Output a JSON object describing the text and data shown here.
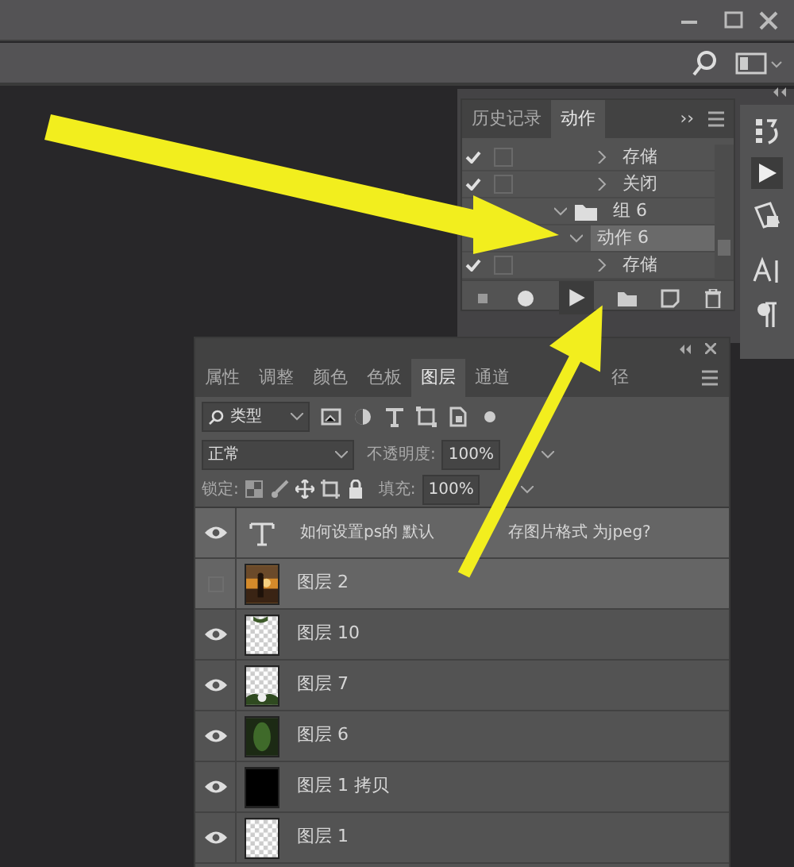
{
  "actions_panel": {
    "tabs": [
      {
        "label": "历史记录",
        "selected": false
      },
      {
        "label": "动作",
        "selected": true
      }
    ],
    "overflow": "››",
    "rows": [
      {
        "label": "存储",
        "checked": true,
        "expanded": false,
        "kind": "step",
        "selected": false
      },
      {
        "label": "关闭",
        "checked": true,
        "expanded": false,
        "kind": "step",
        "selected": false
      },
      {
        "label": "组 6",
        "checked": false,
        "expanded": true,
        "kind": "set",
        "selected": false
      },
      {
        "label": "动作 6",
        "checked": false,
        "expanded": true,
        "kind": "action",
        "selected": true
      },
      {
        "label": "存储",
        "checked": true,
        "expanded": false,
        "kind": "step",
        "selected": false
      }
    ]
  },
  "layers_panel": {
    "tabs": [
      {
        "label": "属性",
        "selected": false
      },
      {
        "label": "调整",
        "selected": false
      },
      {
        "label": "颜色",
        "selected": false
      },
      {
        "label": "色板",
        "selected": false
      },
      {
        "label": "图层",
        "selected": true
      },
      {
        "label": "通道",
        "selected": false
      },
      {
        "label": "径",
        "selected": false
      }
    ],
    "filter": "类型",
    "blend_mode": "正常",
    "opacity_label": "不透明度:",
    "opacity": "100%",
    "lock_label": "锁定:",
    "fill_label": "填充:",
    "fill": "100%",
    "layers": [
      {
        "name_parts": [
          "如何设置ps的 默认",
          "存图片格式 为jpeg?"
        ],
        "visible": true,
        "selected": true,
        "kind": "text"
      },
      {
        "name_parts": [
          "图层 2"
        ],
        "visible": false,
        "selected": true
      },
      {
        "name_parts": [
          "图层 10"
        ],
        "visible": true,
        "selected": false,
        "kind": "foliage"
      },
      {
        "name_parts": [
          "图层 7"
        ],
        "visible": true,
        "selected": false,
        "kind": "flower"
      },
      {
        "name_parts": [
          "图层 6"
        ],
        "visible": true,
        "selected": false,
        "kind": "blur"
      },
      {
        "name_parts": [
          "图层 1 拷贝"
        ],
        "visible": true,
        "selected": false,
        "kind": "fill"
      },
      {
        "name_parts": [
          "图层 1"
        ],
        "visible": true,
        "selected": false,
        "kind": "empty"
      }
    ]
  }
}
